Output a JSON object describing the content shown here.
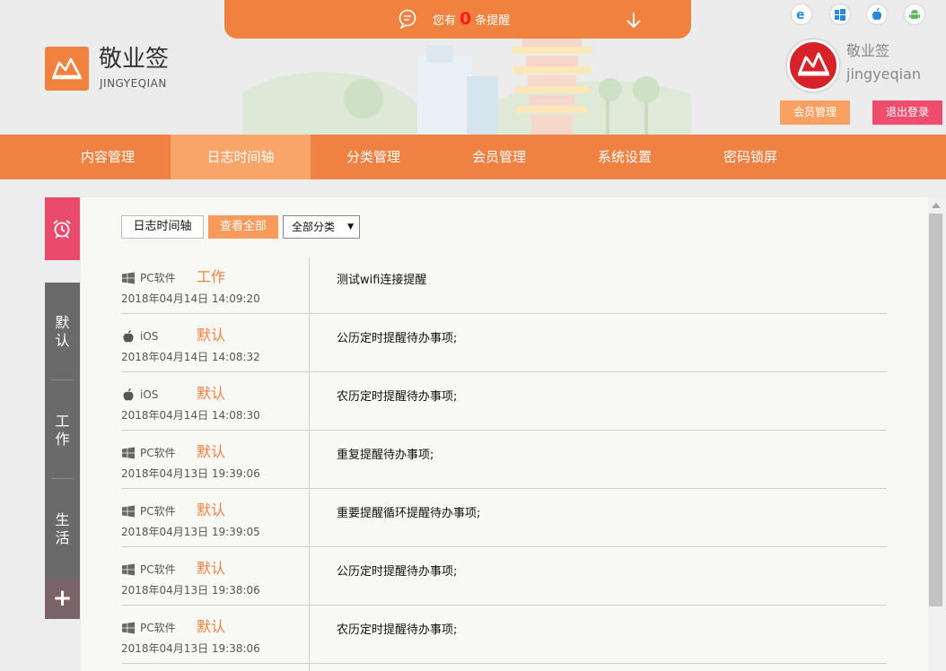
{
  "notice": {
    "prefix": "您有",
    "count": "0",
    "suffix": "条提醒"
  },
  "brand": {
    "name": "敬业签",
    "name_en": "JINGYEQIAN"
  },
  "platforms_header": [
    "ie-icon",
    "windows-icon",
    "apple-icon",
    "android-icon"
  ],
  "user": {
    "name_cn": "敬业签",
    "name_en": "jingyeqian",
    "member_button": "会员管理",
    "logout_button": "退出登录"
  },
  "nav": {
    "items": [
      "内容管理",
      "日志时间轴",
      "分类管理",
      "会员管理",
      "系统设置",
      "密码锁屏"
    ],
    "active": 1
  },
  "side": {
    "tabs": [
      "默认",
      "工作",
      "生活"
    ],
    "plus": "+"
  },
  "toolbar": {
    "timeline": "日志时间轴",
    "view_all": "查看全部",
    "category_select": "全部分类"
  },
  "colors": {
    "accent": "#ef8142",
    "logout": "#ee4d6e",
    "category_text": "#f0813f"
  },
  "log_rows": [
    {
      "platform": "PC软件",
      "platform_icon": "windows-icon",
      "category": "工作",
      "time": "2018年04月14日 14:09:20",
      "content": "测试wifi连接提醒"
    },
    {
      "platform": "iOS",
      "platform_icon": "apple-icon",
      "category": "默认",
      "time": "2018年04月14日 14:08:32",
      "content": "公历定时提醒待办事项;"
    },
    {
      "platform": "iOS",
      "platform_icon": "apple-icon",
      "category": "默认",
      "time": "2018年04月14日 14:08:30",
      "content": "农历定时提醒待办事项;"
    },
    {
      "platform": "PC软件",
      "platform_icon": "windows-icon",
      "category": "默认",
      "time": "2018年04月13日 19:39:06",
      "content": "重复提醒待办事项;"
    },
    {
      "platform": "PC软件",
      "platform_icon": "windows-icon",
      "category": "默认",
      "time": "2018年04月13日 19:39:05",
      "content": "重要提醒循环提醒待办事项;"
    },
    {
      "platform": "PC软件",
      "platform_icon": "windows-icon",
      "category": "默认",
      "time": "2018年04月13日 19:38:06",
      "content": "公历定时提醒待办事项;"
    },
    {
      "platform": "PC软件",
      "platform_icon": "windows-icon",
      "category": "默认",
      "time": "2018年04月13日 19:38:06",
      "content": "农历定时提醒待办事项;"
    }
  ]
}
